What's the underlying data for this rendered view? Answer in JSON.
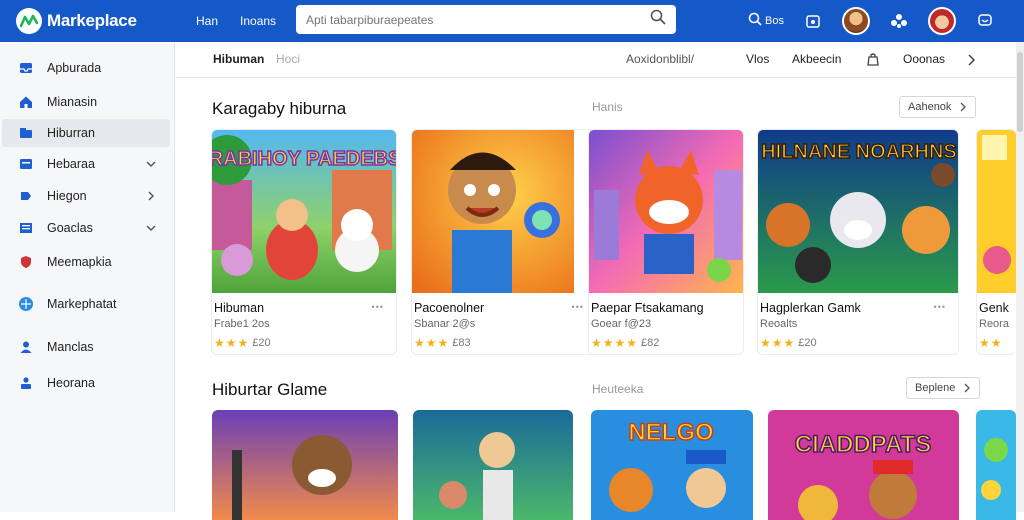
{
  "header": {
    "brand": "Markeplace",
    "links": [
      "Han",
      "Inoans"
    ],
    "search_placeholder": "Apti tabarpiburaepeates",
    "action_label": "Bos"
  },
  "sidebar": {
    "items": [
      {
        "label": "Apburada",
        "icon": "inbox-icon"
      },
      {
        "label": "Mianasin",
        "icon": "home-icon"
      },
      {
        "label": "Hiburran",
        "icon": "folder-icon",
        "active": true
      },
      {
        "label": "Hebaraa",
        "icon": "book-icon",
        "chevron": true
      },
      {
        "label": "Hiegon",
        "icon": "tag-icon",
        "chevron": true
      },
      {
        "label": "Goaclas",
        "icon": "grid-icon",
        "chevron": true
      },
      {
        "label": "Meemapkia",
        "icon": "shield-icon"
      },
      {
        "label": "Markephatat",
        "icon": "globe-icon"
      },
      {
        "label": "Manclas",
        "icon": "user-icon"
      },
      {
        "label": "Heorana",
        "icon": "user-home-icon"
      }
    ]
  },
  "tabs": {
    "left": [
      "Hibuman",
      "Hoci"
    ],
    "right": [
      "Aoxidonblibl/",
      "Vlos",
      "Akbeecin",
      "Ooonas"
    ]
  },
  "sections": [
    {
      "title": "Karagaby hiburna",
      "subtitle": "Hanis",
      "button": "Aahenok",
      "cards": [
        {
          "art_text": "RABIHOY PAEDEBS",
          "title": "Hibuman",
          "sub": "Frabe1 2os",
          "stars": "★★★",
          "rating": "£20"
        },
        {
          "art_text": "",
          "title": "Pacoenolner",
          "sub": "Sbanar 2@s",
          "stars": "★★★",
          "rating": "£83"
        },
        {
          "art_text": "",
          "title": "Paepar Ftsakamang",
          "sub": "Goear f@23",
          "stars": "★★★★",
          "rating": "£82"
        },
        {
          "art_text": "HILNANE NOARHNS",
          "title": "Hagplerkan Gamk",
          "sub": "Reoalts",
          "stars": "★★★",
          "rating": "£20"
        },
        {
          "art_text": "",
          "title": "Genk",
          "sub": "Reora",
          "stars": "★★",
          "rating": ""
        }
      ]
    },
    {
      "title": "Hiburtar Glame",
      "subtitle": "Heuteeka",
      "button": "Beplene",
      "cards": [
        {
          "art_text": ""
        },
        {
          "art_text": ""
        },
        {
          "art_text": "NELGO"
        },
        {
          "art_text": "CIADDPATS"
        },
        {
          "art_text": ""
        }
      ]
    }
  ],
  "colors": {
    "header_bg": "#1558c8",
    "star": "#f2b21b",
    "sidebar_bg": "#f6f7f9"
  }
}
